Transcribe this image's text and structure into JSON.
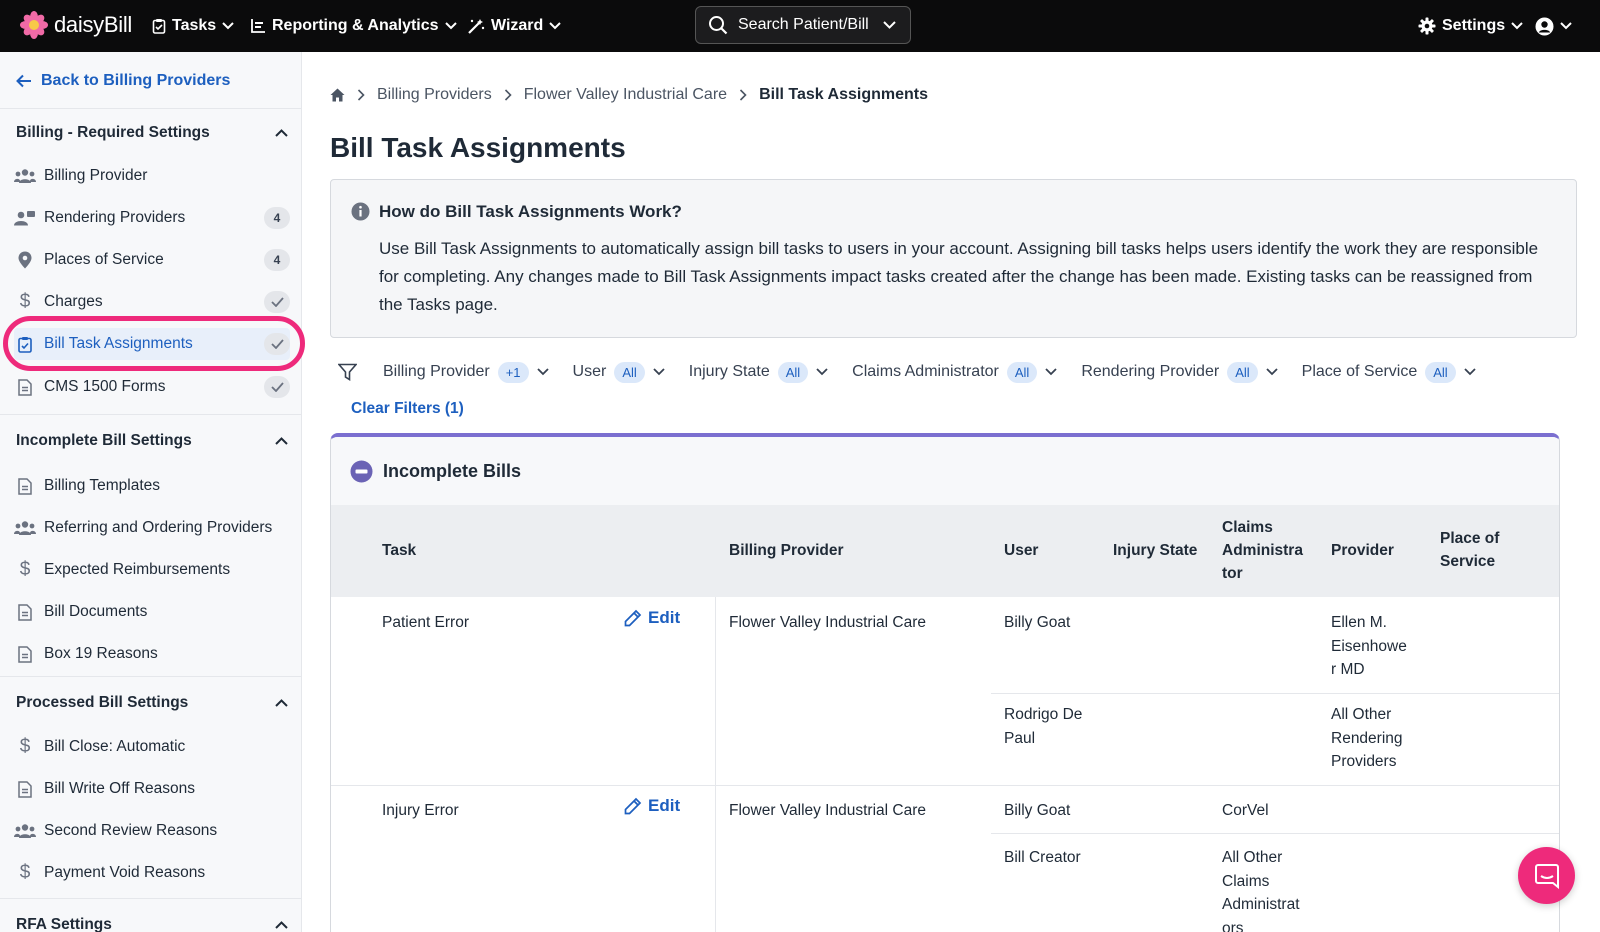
{
  "topbar": {
    "brand": "daisyBill",
    "nav": [
      {
        "label": "Tasks",
        "icon": "clipboard-icon"
      },
      {
        "label": "Reporting & Analytics",
        "icon": "report-icon"
      },
      {
        "label": "Wizard",
        "icon": "wand-icon"
      }
    ],
    "search_label": "Search Patient/Bill",
    "settings_label": "Settings"
  },
  "sidebar": {
    "back_label": "Back to Billing Providers",
    "sections": [
      {
        "title": "Billing - Required Settings",
        "items": [
          {
            "label": "Billing Provider",
            "icon": "users-icon",
            "badge": ""
          },
          {
            "label": "Rendering Providers",
            "icon": "provider-icon",
            "badge": "4"
          },
          {
            "label": "Places of Service",
            "icon": "location-pin-icon",
            "badge": "4"
          },
          {
            "label": "Charges",
            "icon": "dollar-icon",
            "badge": "check"
          },
          {
            "label": "Bill Task Assignments",
            "icon": "clipboard-check-icon",
            "badge": "check",
            "active": true
          },
          {
            "label": "CMS 1500 Forms",
            "icon": "document-icon",
            "badge": "check"
          }
        ]
      },
      {
        "title": "Incomplete Bill Settings",
        "items": [
          {
            "label": "Billing Templates",
            "icon": "document-icon"
          },
          {
            "label": "Referring and Ordering Providers",
            "icon": "users-icon"
          },
          {
            "label": "Expected Reimbursements",
            "icon": "dollar-icon"
          },
          {
            "label": "Bill Documents",
            "icon": "document-icon"
          },
          {
            "label": "Box 19 Reasons",
            "icon": "document-icon"
          }
        ]
      },
      {
        "title": "Processed Bill Settings",
        "items": [
          {
            "label": "Bill Close: Automatic",
            "icon": "dollar-icon"
          },
          {
            "label": "Bill Write Off Reasons",
            "icon": "document-icon"
          },
          {
            "label": "Second Review Reasons",
            "icon": "users-icon"
          },
          {
            "label": "Payment Void Reasons",
            "icon": "dollar-icon"
          }
        ]
      },
      {
        "title": "RFA Settings",
        "items": []
      }
    ]
  },
  "breadcrumb": [
    "Billing Providers",
    "Flower Valley Industrial Care",
    "Bill Task Assignments"
  ],
  "page_title": "Bill Task Assignments",
  "info": {
    "title": "How do Bill Task Assignments Work?",
    "text": "Use Bill Task Assignments to automatically assign bill tasks to users in your account. Assigning bill tasks helps users identify the work they are responsible for completing. Any changes made to Bill Task Assignments impact tasks created after the change has been made. Existing tasks can be reassigned from the Tasks page."
  },
  "filters": [
    {
      "label": "Billing Provider",
      "chip": "+1"
    },
    {
      "label": "User",
      "chip": "All"
    },
    {
      "label": "Injury State",
      "chip": "All"
    },
    {
      "label": "Claims Administrator",
      "chip": "All"
    },
    {
      "label": "Rendering Provider",
      "chip": "All"
    },
    {
      "label": "Place of Service",
      "chip": "All"
    }
  ],
  "clear_filters": "Clear Filters (1)",
  "panel": {
    "title": "Incomplete Bills",
    "edit_label": "Edit",
    "columns": [
      "Task",
      "Billing Provider",
      "User",
      "Injury State",
      "Claims Administrator",
      "Provider",
      "Place of Service"
    ],
    "column_display": {
      "claims": [
        "Claims",
        "Administra",
        "tor"
      ],
      "place": [
        "Place of",
        "Service"
      ]
    },
    "rows": [
      {
        "task": "Patient Error",
        "billing_provider": "Flower Valley Industrial Care",
        "assignments": [
          {
            "user": "Billy Goat",
            "injury_state": "",
            "claims_admin": "",
            "provider": "Ellen M. Eisenhower MD",
            "provider_lines": [
              "Ellen M.",
              "Eisenhowe",
              "r MD"
            ]
          },
          {
            "user": "Rodrigo De Paul",
            "user_lines": [
              "Rodrigo De",
              "Paul"
            ],
            "injury_state": "",
            "claims_admin": "",
            "provider": "All Other Rendering Providers",
            "provider_lines": [
              "All Other",
              "Rendering",
              "Providers"
            ]
          }
        ]
      },
      {
        "task": "Injury Error",
        "billing_provider": "Flower Valley Industrial Care",
        "assignments": [
          {
            "user": "Billy Goat",
            "injury_state": "",
            "claims_admin": "CorVel",
            "provider": ""
          },
          {
            "user": "Bill Creator",
            "injury_state": "",
            "claims_admin": "All Other Claims Administrators",
            "claims_lines": [
              "All Other",
              "Claims",
              "Administrat",
              "ors"
            ],
            "provider": ""
          }
        ]
      }
    ]
  },
  "colors": {
    "topbar_bg": "#0b0b0c",
    "link_blue": "#1d5fbf",
    "highlight_pink": "#ee2a7b",
    "panel_accent": "#7b6fd0"
  }
}
